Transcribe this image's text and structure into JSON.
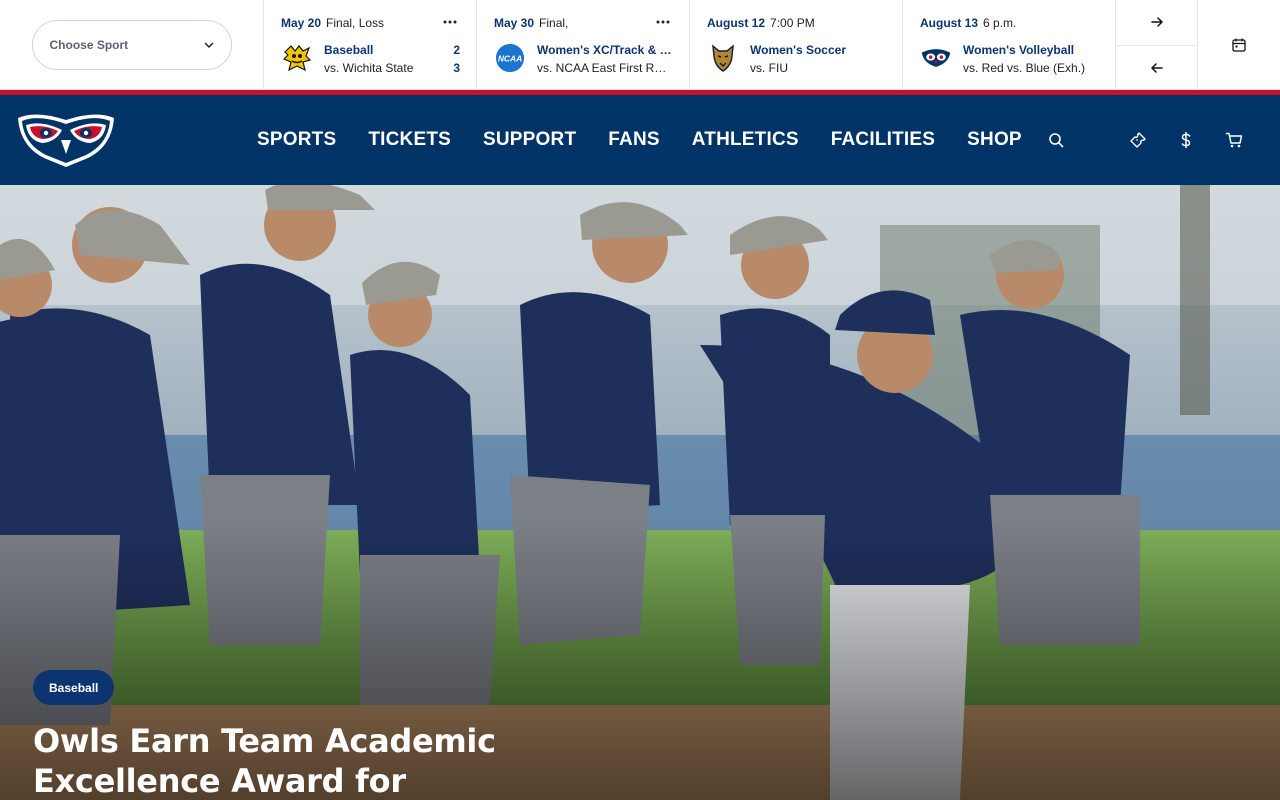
{
  "scoreboard": {
    "sport_select": {
      "label": "Choose Sport",
      "icon": "chevron-down-icon"
    },
    "games": [
      {
        "date": "May 20",
        "status": "Final, Loss",
        "sport": "Baseball",
        "opponent": "vs. Wichita State",
        "score_home": "2",
        "score_away": "3",
        "logo": "wichita-state-logo"
      },
      {
        "date": "May 30",
        "status": "Final,",
        "sport": "Women's XC/Track & Field",
        "opponent": "vs. NCAA East First Round",
        "score_home": "",
        "score_away": "",
        "logo": "ncaa-logo"
      },
      {
        "date": "August 12",
        "status": "7:00 PM",
        "sport": "Women's Soccer",
        "opponent": "vs. FIU",
        "score_home": "",
        "score_away": "",
        "logo": "fiu-logo"
      },
      {
        "date": "August 13",
        "status": "6 p.m.",
        "sport": "Women's Volleyball",
        "opponent": "vs. Red vs. Blue (Exh.)",
        "score_home": "",
        "score_away": "",
        "logo": "fau-owl-logo"
      }
    ],
    "more_icon": "ellipsis-icon",
    "next_icon": "arrow-right-icon",
    "prev_icon": "arrow-left-icon",
    "calendar_icon": "calendar-icon"
  },
  "nav": {
    "logo": "fau-owls-logo",
    "items": [
      "SPORTS",
      "TICKETS",
      "SUPPORT",
      "FANS",
      "ATHLETICS",
      "FACILITIES",
      "SHOP"
    ],
    "search_icon": "search-icon",
    "icons": [
      "ticket-icon",
      "dollar-icon",
      "cart-icon"
    ]
  },
  "hero": {
    "tag": "Baseball",
    "title": "Owls Earn Team Academic Excellence Award for"
  },
  "colors": {
    "navy": "#003366",
    "red": "#c8102e",
    "link_navy": "#0b3470",
    "border": "#e3e6ea"
  }
}
